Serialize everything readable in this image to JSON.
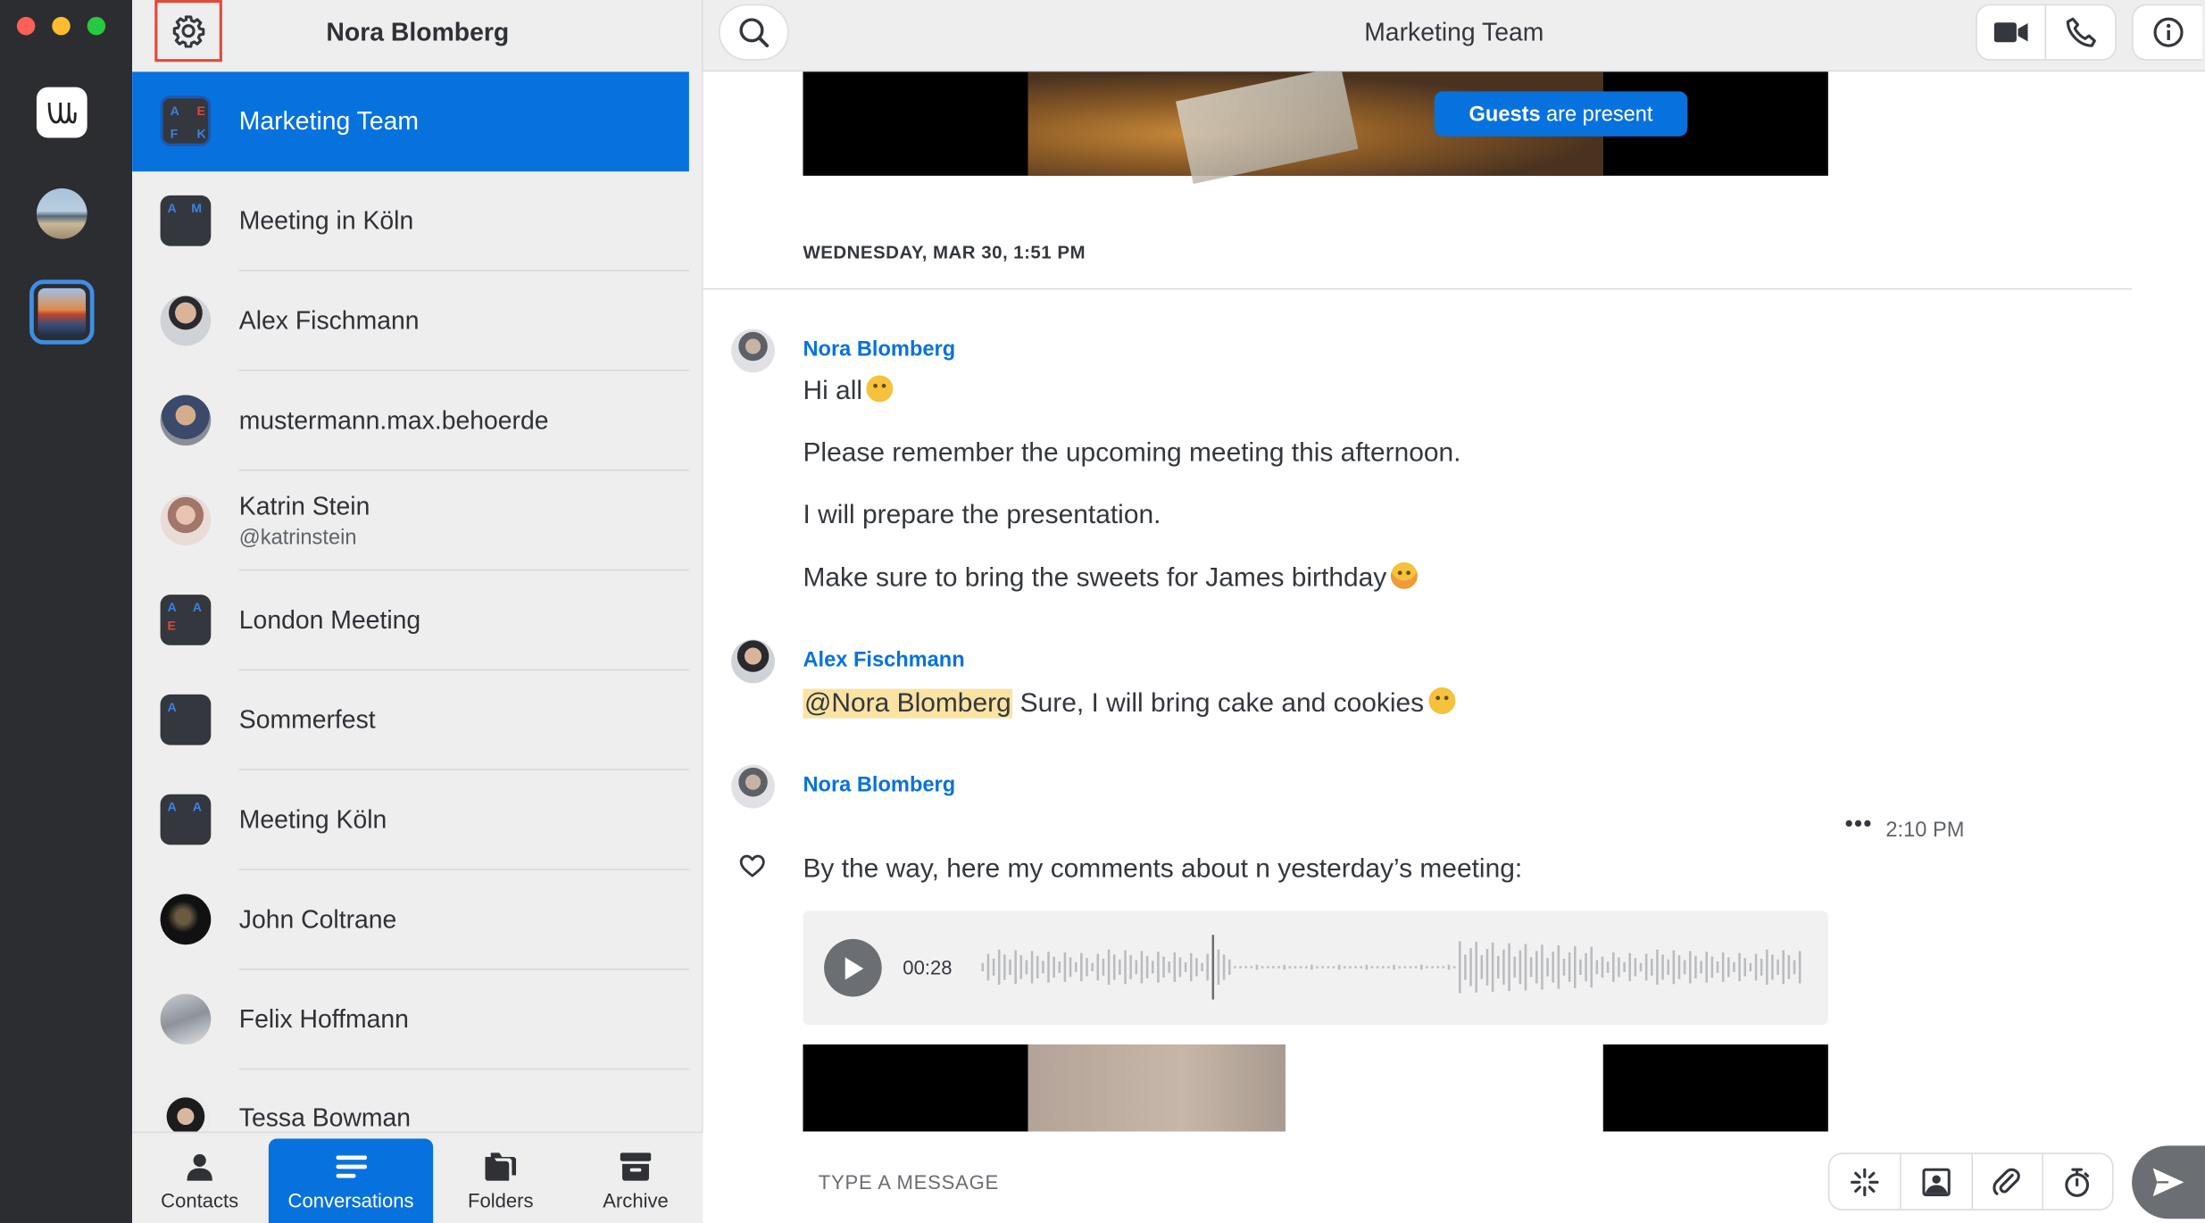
{
  "window": {
    "account_name": "Nora Blomberg",
    "conversation_title": "Marketing Team"
  },
  "conversations": [
    {
      "label": "Marketing Team",
      "type": "group",
      "letters": [
        "A",
        "E",
        "F",
        "K"
      ],
      "active": true
    },
    {
      "label": "Meeting in Köln",
      "type": "group",
      "letters": [
        "A",
        "M"
      ]
    },
    {
      "label": "Alex Fischmann",
      "type": "person"
    },
    {
      "label": "mustermann.max.behoerde",
      "type": "person"
    },
    {
      "label": "Katrin Stein",
      "sublabel": "@katrinstein",
      "type": "person"
    },
    {
      "label": "London Meeting",
      "type": "group",
      "letters": [
        "A",
        "A",
        "E"
      ]
    },
    {
      "label": "Sommerfest",
      "type": "group",
      "letters": [
        "A"
      ]
    },
    {
      "label": "Meeting Köln",
      "type": "group",
      "letters": [
        "A",
        "A"
      ]
    },
    {
      "label": "John Coltrane",
      "type": "person"
    },
    {
      "label": "Felix Hoffmann",
      "type": "person"
    },
    {
      "label": "Tessa Bowman",
      "type": "person"
    }
  ],
  "footer_tabs": [
    {
      "label": "Contacts",
      "icon": "person-icon"
    },
    {
      "label": "Conversations",
      "icon": "conversations-icon",
      "active": true
    },
    {
      "label": "Folders",
      "icon": "folders-icon"
    },
    {
      "label": "Archive",
      "icon": "archive-icon"
    }
  ],
  "banner": {
    "guests_bold": "Guests",
    "guests_rest": "are present"
  },
  "day_separator": "WEDNESDAY, MAR 30, 1:51 PM",
  "messages": [
    {
      "author": "Nora Blomberg",
      "lines": [
        "Hi all",
        "Please remember the upcoming meeting this afternoon.",
        "I will prepare the presentation.",
        "Make sure to bring the sweets for James birthday"
      ]
    },
    {
      "author": "Alex Fischmann",
      "mention": "@Nora Blomberg",
      "text": "Sure, I will bring cake and cookies"
    },
    {
      "author": "Nora Blomberg",
      "time": "2:10 PM",
      "more": "•••",
      "text": "By the way, here my comments about n yesterday’s meeting:",
      "audio_duration": "00:28"
    }
  ],
  "composer": {
    "placeholder": "TYPE A MESSAGE"
  },
  "colors": {
    "accent": "#0772de",
    "rail": "#2c2d30",
    "sidebar": "#eeeeef",
    "mention_highlight": "#fbe3a3"
  }
}
